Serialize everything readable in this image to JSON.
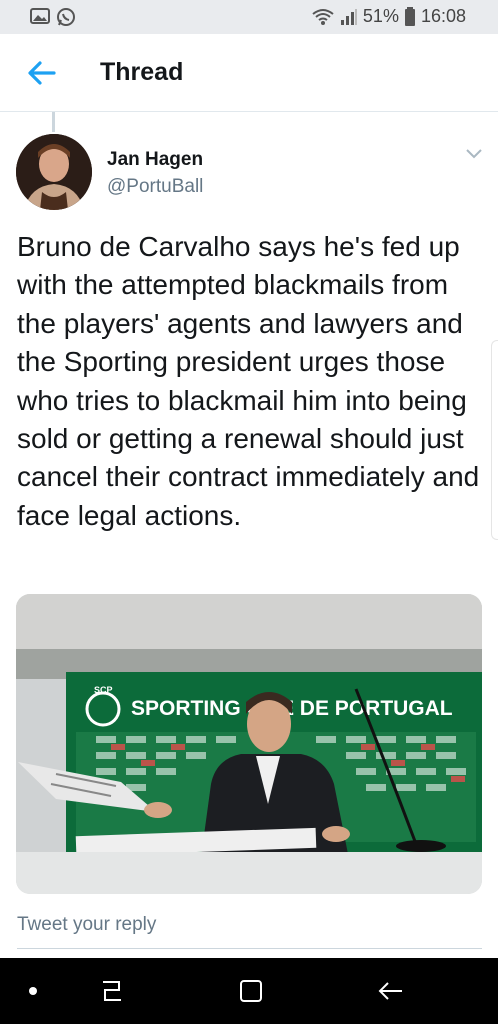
{
  "status_bar": {
    "left_icons": [
      "gallery-icon",
      "whatsapp-icon"
    ],
    "battery": "51%",
    "time": "16:08",
    "right_icons": [
      "wifi-icon",
      "signal-icon",
      "battery-icon"
    ]
  },
  "header": {
    "title": "Thread"
  },
  "tweet": {
    "name": "Jan Hagen",
    "handle": "@PortuBall",
    "text": "Bruno de Carvalho says he's fed up with the attempted blackmails from the players' agents and lawyers and the Sporting president urges those who tries to blackmail him into being sold or getting a renewal should just cancel their contract immediately and face legal actions.",
    "media": {
      "banner_text": "SPORTING CL   E DE PORTUGAL",
      "crest_text": "SCP"
    }
  },
  "reply": {
    "placeholder": "Tweet your reply"
  },
  "nav": {
    "buttons": [
      "dot-icon",
      "recent-apps-icon",
      "home-icon",
      "back-icon"
    ]
  },
  "colors": {
    "accent": "#1da1f2",
    "text": "#14171a",
    "muted": "#657786",
    "sporting_green": "#0c6b3a"
  }
}
